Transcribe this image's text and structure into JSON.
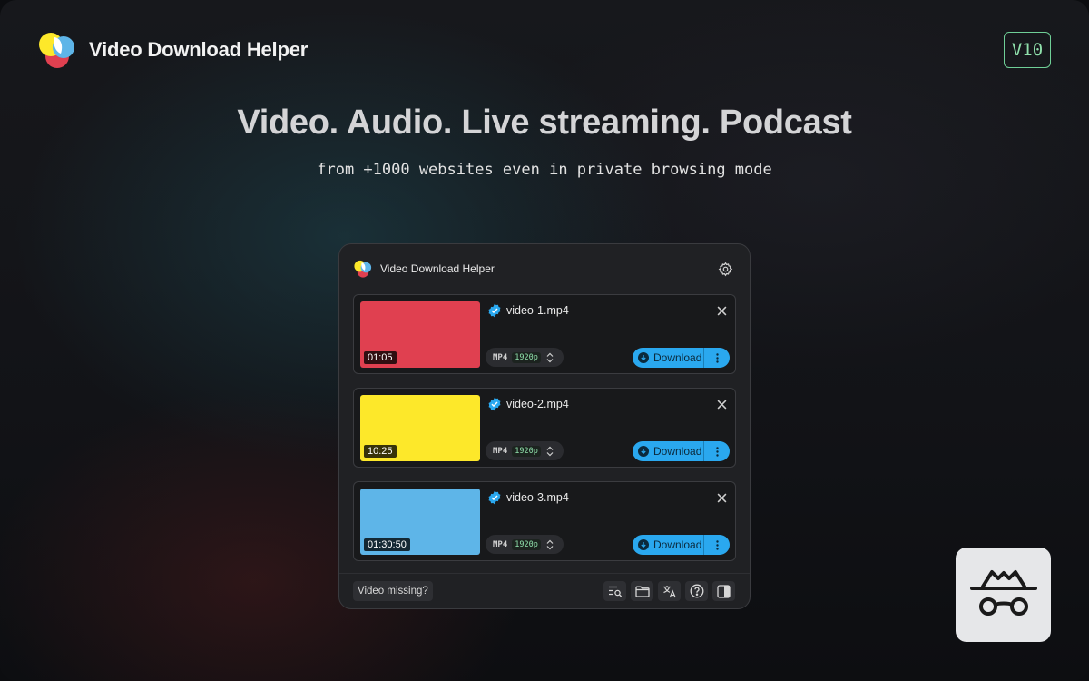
{
  "brand": {
    "name": "Video Download Helper",
    "version": "V10"
  },
  "hero": {
    "headline": "Video. Audio. Live streaming. Podcast",
    "subline": "from +1000 websites even in private browsing mode"
  },
  "panel": {
    "title": "Video Download Helper",
    "items": [
      {
        "filename": "video-1.mp4",
        "duration": "01:05",
        "thumb_color": "#e04050",
        "format": "MP4",
        "resolution": "1920p",
        "action": "Download"
      },
      {
        "filename": "video-2.mp4",
        "duration": "10:25",
        "thumb_color": "#fde82a",
        "format": "MP4",
        "resolution": "1920p",
        "action": "Download"
      },
      {
        "filename": "video-3.mp4",
        "duration": "01:30:50",
        "thumb_color": "#5eb5e8",
        "format": "MP4",
        "resolution": "1920p",
        "action": "Download"
      }
    ],
    "footer": {
      "missing_label": "Video missing?",
      "icons": [
        "search-list-icon",
        "folder-icon",
        "translate-icon",
        "help-icon",
        "sidebar-icon"
      ]
    }
  },
  "colors": {
    "accent": "#2aa8ef",
    "version_green": "#6fcf97"
  },
  "badge_icon": "incognito-icon"
}
